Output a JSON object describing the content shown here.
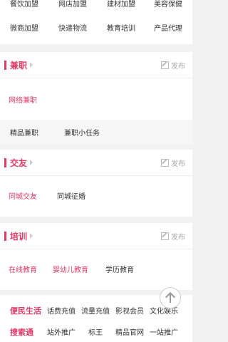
{
  "top_grid": {
    "row1": [
      "餐饮加盟",
      "网店加盟",
      "建材加盟",
      "美容保健"
    ],
    "row2": [
      "微商加盟",
      "快递物流",
      "教育培训",
      "产品代理"
    ]
  },
  "sections": {
    "parttime": {
      "title": "兼职",
      "post_label": "发布",
      "links": [
        "网络兼职"
      ],
      "subrow": [
        "精品兼职",
        "兼职小任务"
      ]
    },
    "social": {
      "title": "交友",
      "post_label": "发布",
      "links": [
        "同城交友",
        "同城征婚"
      ]
    },
    "training": {
      "title": "培训",
      "post_label": "发布",
      "links": [
        "在线教育",
        "婴幼儿教育",
        "学历教育"
      ]
    }
  },
  "bottom": {
    "row1": {
      "lead": "便民生活",
      "items": [
        "话费充值",
        "流量充值",
        "影视会员",
        "文化娱乐"
      ]
    },
    "row2": {
      "lead": "搜索通",
      "items": [
        "站外推广",
        "标王",
        "精品官网",
        "一站推广"
      ]
    }
  },
  "colors": {
    "accent": "#e23a64"
  },
  "icons": {
    "post": "edit-icon",
    "scroll_top": "arrow-up-icon"
  }
}
